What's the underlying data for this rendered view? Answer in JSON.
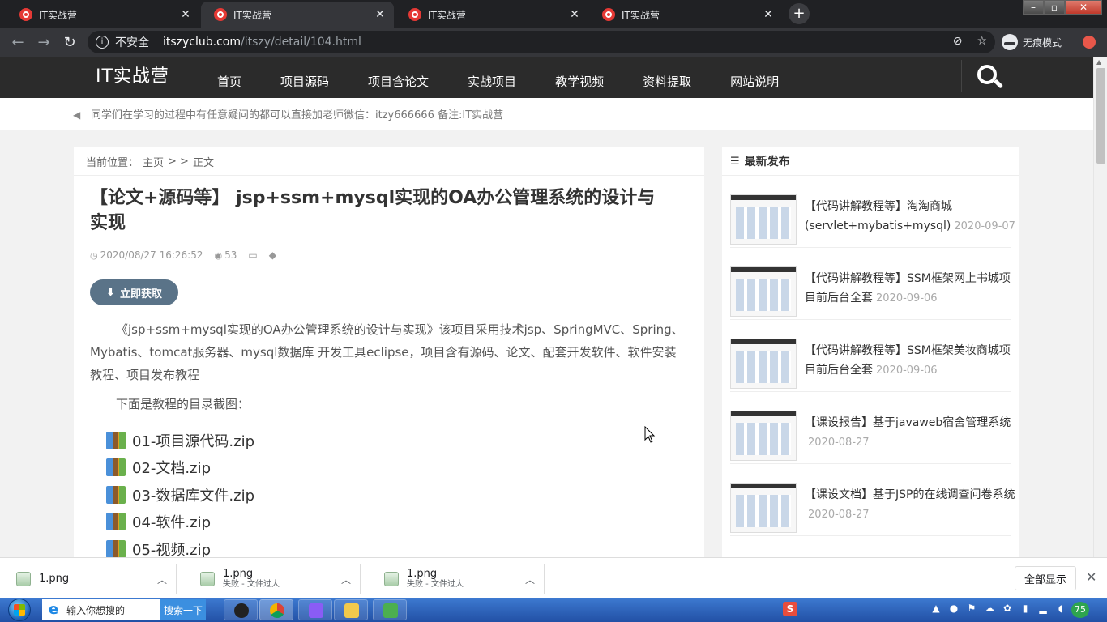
{
  "browser": {
    "tabs": [
      {
        "title": "IT实战营",
        "active": false
      },
      {
        "title": "IT实战营",
        "active": true
      },
      {
        "title": "IT实战营",
        "active": false
      },
      {
        "title": "IT实战营",
        "active": false
      }
    ],
    "new_tab_label": "+",
    "security_label": "不安全",
    "url_host": "itszyclub.com",
    "url_path": "/itszy/detail/104.html",
    "incognito_label": "无痕模式"
  },
  "site": {
    "logo": "IT实战营",
    "nav": [
      "首页",
      "项目源码",
      "项目含论文",
      "实战项目",
      "教学视频",
      "资料提取",
      "网站说明"
    ],
    "notice": "同学们在学习的过程中有任意疑问的都可以直接加老师微信：itzy666666 备注:IT实战营"
  },
  "article": {
    "breadcrumb_prefix": "当前位置：",
    "breadcrumb_home": "主页",
    "breadcrumb_sep": "> >",
    "breadcrumb_current": "正文",
    "title": "【论文+源码等】 jsp+ssm+mysql实现的OA办公管理系统的设计与实现",
    "date": "2020/08/27 16:26:52",
    "views": "53",
    "get_button": "立即获取",
    "paragraph": "《jsp+ssm+mysql实现的OA办公管理系统的设计与实现》该项目采用技术jsp、SpringMVC、Spring、Mybatis、tomcat服务器、mysql数据库 开发工具eclipse，项目含有源码、论文、配套开发软件、软件安装教程、项目发布教程",
    "subheading": "下面是教程的目录截图：",
    "files": [
      "01-项目源代码.zip",
      "02-文档.zip",
      "03-数据库文件.zip",
      "04-软件.zip",
      "05-视频.zip"
    ]
  },
  "sidebar": {
    "heading": "最新发布",
    "posts": [
      {
        "title": "【代码讲解教程等】淘淘商城(servlet+mybatis+mysql)",
        "date": "2020-09-07"
      },
      {
        "title": "【代码讲解教程等】SSM框架网上书城项目前后台全套",
        "date": "2020-09-06"
      },
      {
        "title": "【代码讲解教程等】SSM框架美妆商城项目前后台全套",
        "date": "2020-09-06"
      },
      {
        "title": "【课设报告】基于javaweb宿舍管理系统",
        "date": "2020-08-27"
      },
      {
        "title": "【课设文档】基于JSP的在线调查问卷系统",
        "date": "2020-08-27"
      }
    ]
  },
  "downloads": {
    "items": [
      {
        "name": "1.png",
        "status": ""
      },
      {
        "name": "1.png",
        "status": "失败 - 文件过大"
      },
      {
        "name": "1.png",
        "status": "失败 - 文件过大"
      }
    ],
    "show_all": "全部显示"
  },
  "taskbar": {
    "search_placeholder": "输入你想搜的",
    "search_button": "搜索一下",
    "battery": "75",
    "ime_label": "S"
  },
  "colors": {
    "site_nav_bg": "#2b2b2b",
    "get_button_bg": "#5a7388",
    "browser_dark": "#202124"
  }
}
